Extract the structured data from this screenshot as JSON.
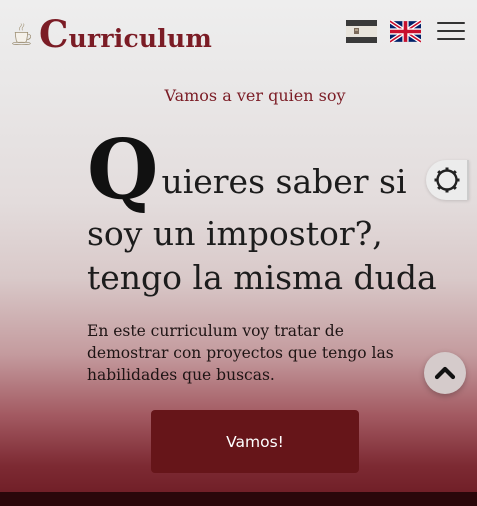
{
  "header": {
    "logo_icon": "coffee-cup-icon",
    "logo_initial": "C",
    "logo_rest": "urriculum",
    "flags": [
      {
        "name": "spanish-flag-icon",
        "lang": "es"
      },
      {
        "name": "uk-flag-icon",
        "lang": "en"
      }
    ],
    "menu_icon": "hamburger-menu-icon"
  },
  "hero": {
    "subtitle": "Vamos a ver quien soy",
    "dropcap": "Q",
    "line1": "uieres saber si",
    "line2": "soy un impostor?,",
    "line3": "tengo la misma duda",
    "description": "En este curriculum voy tratar de demostrar con proyectos que tengo las habilidades que buscas.",
    "cta_label": "Vamos!"
  },
  "floating": {
    "settings_icon": "gear-icon",
    "scroll_top_icon": "chevron-up-icon"
  },
  "colors": {
    "brand": "#7b1c25",
    "button": "#661519",
    "footer": "#2a070a"
  }
}
